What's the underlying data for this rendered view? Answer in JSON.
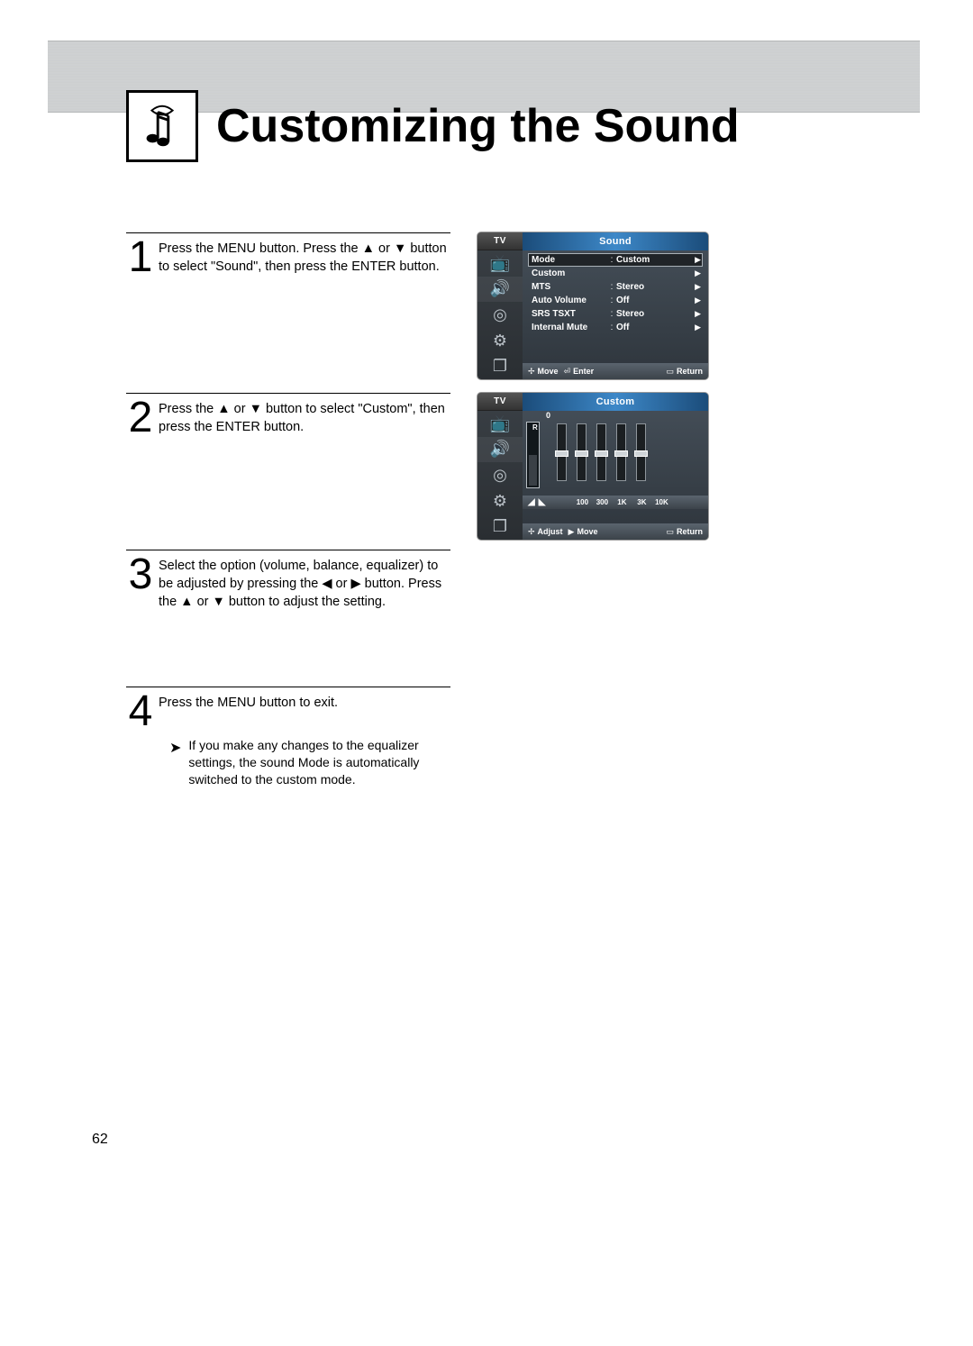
{
  "title": "Customizing the Sound",
  "page_number": "62",
  "steps": {
    "s1": {
      "num": "1",
      "text": "Press the MENU button. Press the ▲ or ▼ button to select \"Sound\", then press the ENTER button."
    },
    "s2": {
      "num": "2",
      "text": "Press the ▲ or ▼ button to select \"Custom\", then press the ENTER button."
    },
    "s3": {
      "num": "3",
      "text": "Select the option (volume, balance, equalizer) to be adjusted by pressing the ◀ or ▶ button. Press the ▲ or ▼ button to adjust the setting."
    },
    "s4": {
      "num": "4",
      "text": "Press the MENU button to exit."
    }
  },
  "note": "If you make any changes to the equalizer settings, the sound Mode is automatically switched to the custom mode.",
  "osd1": {
    "tv": "TV",
    "title": "Sound",
    "rows": [
      {
        "label": "Mode",
        "value": "Custom"
      },
      {
        "label": "Custom",
        "value": ""
      },
      {
        "label": "MTS",
        "value": "Stereo"
      },
      {
        "label": "Auto Volume",
        "value": "Off"
      },
      {
        "label": "SRS TSXT",
        "value": "Stereo"
      },
      {
        "label": "Internal Mute",
        "value": "Off"
      }
    ],
    "hint": {
      "move": "Move",
      "enter": "Enter",
      "ret": "Return"
    }
  },
  "osd2": {
    "tv": "TV",
    "title": "Custom",
    "zero": "0",
    "balance_R": "R",
    "bands": [
      "100",
      "300",
      "1K",
      "3K",
      "10K"
    ],
    "hint": {
      "adjust": "Adjust",
      "move": "Move",
      "ret": "Return"
    }
  }
}
